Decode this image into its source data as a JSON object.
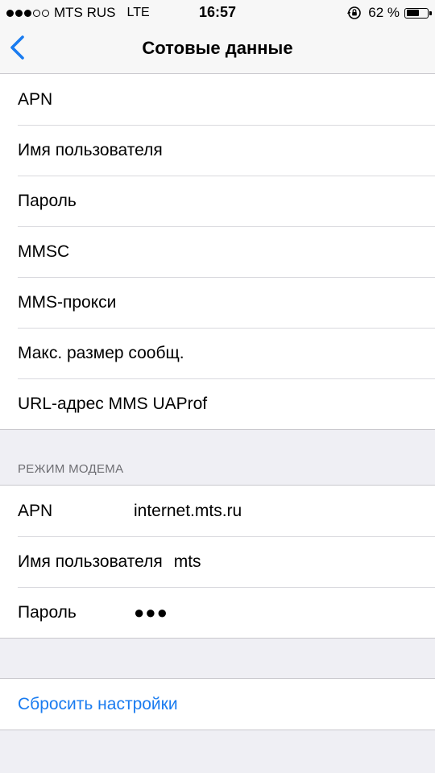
{
  "status_bar": {
    "signal_dots": [
      "full",
      "full",
      "full",
      "empty",
      "empty"
    ],
    "carrier": "MTS RUS",
    "network": "LTE",
    "time": "16:57",
    "battery_percent": "62 %",
    "battery_level": 0.62,
    "lock_icon": "rotation-lock-icon"
  },
  "nav": {
    "back_icon": "chevron-left-icon",
    "title": "Сотовые данные"
  },
  "cellular_fields": [
    {
      "label": "APN"
    },
    {
      "label": "Имя пользователя"
    },
    {
      "label": "Пароль"
    },
    {
      "label": "MMSC"
    },
    {
      "label": "MMS-прокси"
    },
    {
      "label": "Макс. размер сообщ."
    },
    {
      "label": "URL-адрес MMS UAProf"
    }
  ],
  "modem_section": {
    "header": "РЕЖИМ МОДЕМА",
    "fields": [
      {
        "label": "APN",
        "value": "internet.mts.ru"
      },
      {
        "label": "Имя пользователя",
        "value": "mts"
      },
      {
        "label": "Пароль",
        "value": "●●●"
      }
    ]
  },
  "reset": {
    "label": "Сбросить настройки"
  },
  "colors": {
    "accent": "#1a7cf0",
    "background": "#efeff4",
    "section_header": "#6d6d72"
  }
}
